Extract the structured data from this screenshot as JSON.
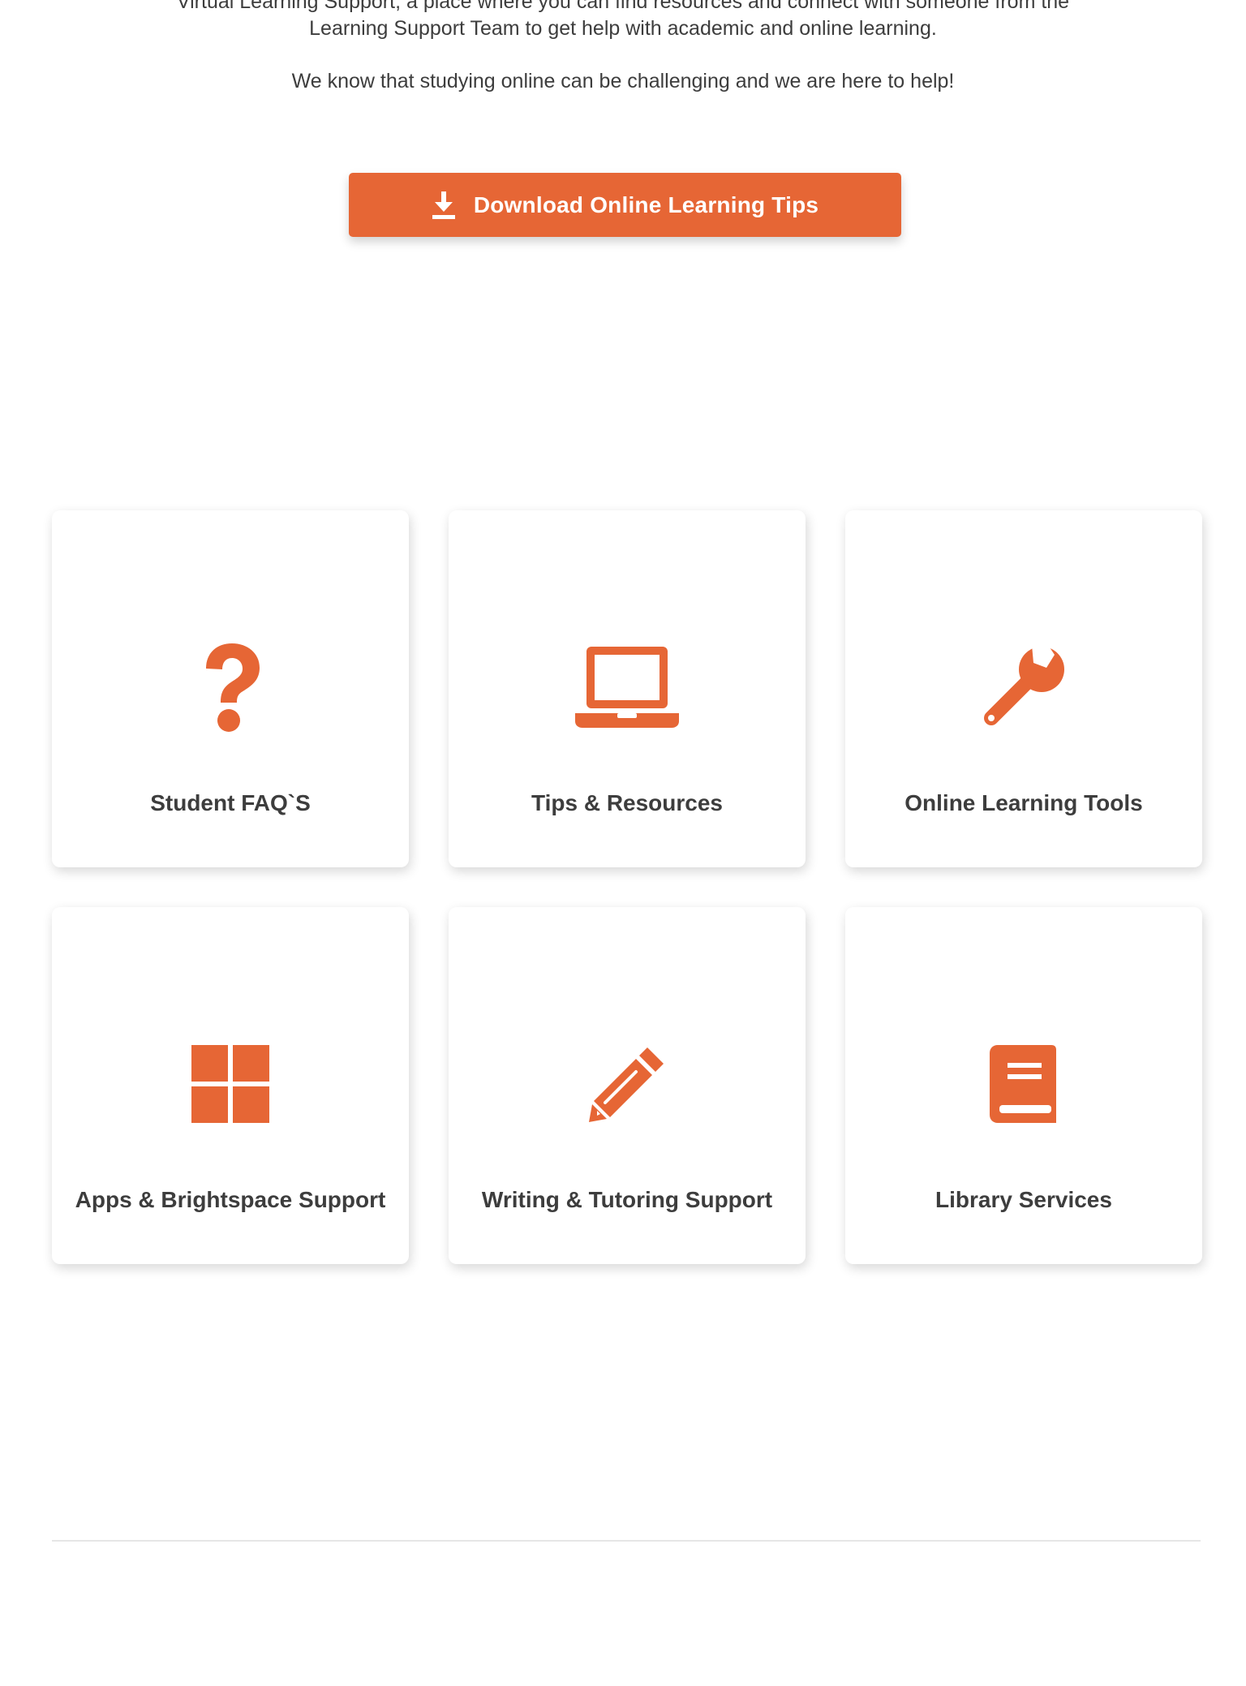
{
  "intro": {
    "paragraph_1": "Virtual Learning Support, a place where you can find resources and connect with someone from the Learning Support Team to get help with academic and online learning.",
    "paragraph_2": "We know that studying online can be challenging and we are here to help!"
  },
  "download_button": {
    "label": "Download Online Learning Tips",
    "icon": "download-icon"
  },
  "cards": [
    {
      "label": "Student FAQ`S",
      "icon": "question-mark-icon"
    },
    {
      "label": "Tips & Resources",
      "icon": "laptop-icon"
    },
    {
      "label": "Online Learning Tools",
      "icon": "wrench-icon"
    },
    {
      "label": "Apps & Brightspace Support",
      "icon": "windows-grid-icon"
    },
    {
      "label": "Writing & Tutoring Support",
      "icon": "pencil-icon"
    },
    {
      "label": "Library Services",
      "icon": "book-icon"
    }
  ],
  "colors": {
    "accent": "#e66635",
    "text": "#3d3d3d",
    "background": "#ffffff",
    "divider": "#e6e6e6"
  }
}
